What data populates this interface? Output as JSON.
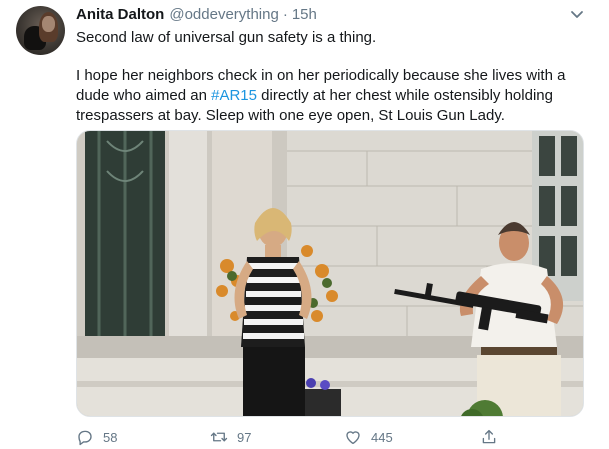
{
  "tweet": {
    "author_name": "Anita Dalton",
    "handle": "@oddeverything",
    "separator": "·",
    "time": "15h",
    "text_line1": "Second law of universal gun safety is a thing.",
    "text_p2_before": "I hope her neighbors check in on her periodically because she lives with a dude who aimed an ",
    "hashtag": "#AR15",
    "text_p2_after": " directly at her chest while ostensibly holding trespassers at bay. Sleep with one eye open, St Louis Gun Lady."
  },
  "actions": {
    "reply_count": "58",
    "retweet_count": "97",
    "like_count": "445"
  },
  "icons": {
    "menu": "chevron-down-icon",
    "reply": "reply-icon",
    "retweet": "retweet-icon",
    "like": "heart-icon",
    "share": "share-icon"
  },
  "colors": {
    "text": "#14171a",
    "secondary": "#657786",
    "link": "#1b95e0"
  }
}
